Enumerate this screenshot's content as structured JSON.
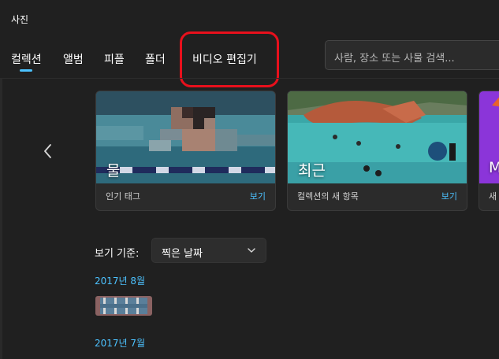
{
  "app": {
    "title": "사진"
  },
  "nav": {
    "items": [
      {
        "label": "컬렉션",
        "active": true
      },
      {
        "label": "앨범"
      },
      {
        "label": "피플"
      },
      {
        "label": "폴더"
      },
      {
        "label": "비디오 편집기"
      }
    ]
  },
  "search": {
    "placeholder": "사람, 장소 또는 사물 검색..."
  },
  "cards": [
    {
      "title": "물",
      "caption": "인기 태그",
      "action": "보기"
    },
    {
      "title": "최근",
      "caption": "컬렉션의 새 항목",
      "action": "보기"
    },
    {
      "title": "M",
      "caption": "새"
    }
  ],
  "sort": {
    "label": "보기 기준:",
    "value": "찍은 날짜"
  },
  "timeline": [
    {
      "month": "2017년 8월"
    },
    {
      "month": "2017년 7월"
    }
  ],
  "colors": {
    "accent": "#4cc2ff",
    "highlight": "#e8101c",
    "background": "#202020"
  },
  "icons": [
    "chevron-left-icon",
    "chevron-down-icon"
  ]
}
